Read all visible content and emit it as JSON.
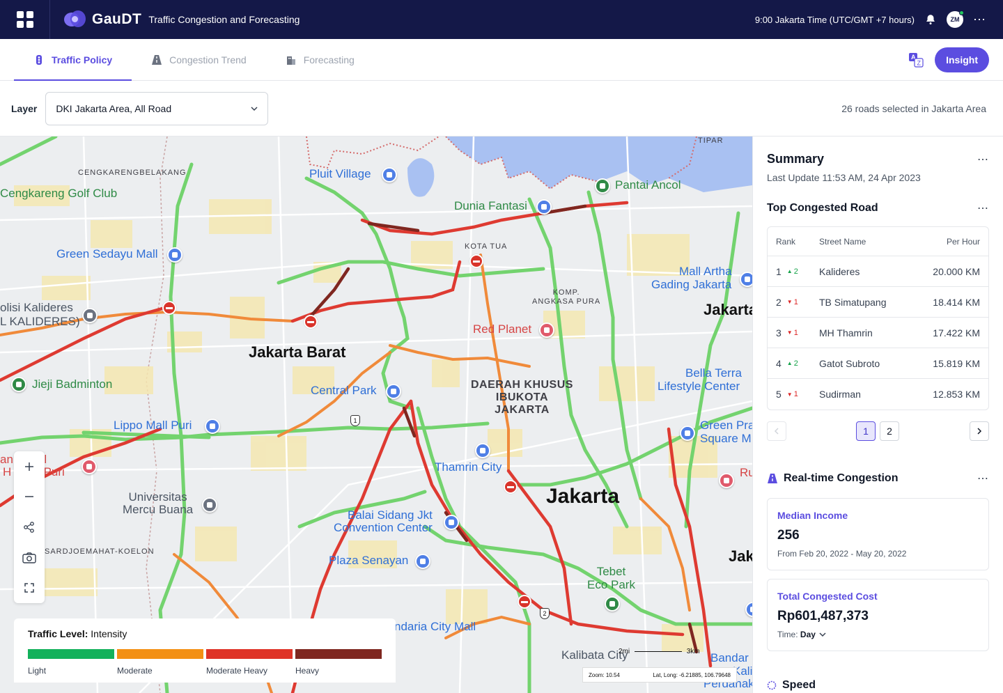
{
  "header": {
    "brand": "GauDT",
    "subtitle": "Traffic Congestion and Forecasting",
    "time": "9:00 Jakarta Time (UTC/GMT +7 hours)",
    "avatar_initials": "ZM",
    "more": "⋯"
  },
  "tabs": [
    {
      "label": "Traffic Policy",
      "active": true,
      "icon": "traffic-light-icon"
    },
    {
      "label": "Congestion Trend",
      "active": false,
      "icon": "road-icon"
    },
    {
      "label": "Forecasting",
      "active": false,
      "icon": "building-icon"
    }
  ],
  "insight_label": "Insight",
  "layer": {
    "label": "Layer",
    "value": "DKI Jakarta Area, All Road",
    "info": "26 roads selected in Jakarta Area"
  },
  "map": {
    "labels": {
      "cengkareng_belakang": "CENGKARENGBELAKANG",
      "golf_club": "Cengkareng Golf Club",
      "pluit_village": "Pluit Village",
      "dunia_fantasi": "Dunia Fantasi",
      "pantai_ancol": "Pantai Ancol",
      "tipar": "TIPAR",
      "kota_tua": "KOTA TUA",
      "green_sedayu": "Green Sedayu Mall",
      "mall_artha": "Mall Artha",
      "gading_jakarta": "Gading Jakarta",
      "komp_angkasa": "KOMP.\nANGKASA PURA",
      "polisi_kalideres": "olisi Kalideres",
      "polisi_kalideres2": "L KALIDERES)",
      "jakarta_right": "Jakarta",
      "red_planet": "Red Planet",
      "jakarta_barat": "Jakarta Barat",
      "jieji": "Jieji Badminton",
      "bella_terra": "Bella Terra",
      "lifestyle_center": "Lifestyle Center",
      "central_park": "Central Park",
      "dki": "DAERAH KHUSUS\nIBUKOTA\nJAKARTA",
      "lippo": "Lippo Mall Puri",
      "green_pra": "Green Pra",
      "square_m": "Square M",
      "royal1": "an Royal",
      "royal2": "H      al Puri",
      "thamrin_city": "Thamrin City",
      "ru": "Ru",
      "universitas": "Universitas\nMercu Buana",
      "jakarta_big": "Jakarta",
      "balai": "Balai Sidang Jkt",
      "convention": "Convention Center",
      "sardjo": "SARDJOEMAHAT-KOELON",
      "jak": "Jak",
      "plaza_senayan": "Plaza Senayan",
      "tebet": "Tebet\nEco Park",
      "ndaria": "ndaria City Mall",
      "kalibata": "Kalibata City",
      "bandar": "Bandar",
      "kali": "Kali",
      "perdanakus": "Perdanakus",
      "shield1": "1",
      "shield2": "2"
    },
    "scale": {
      "mi": "2mi",
      "km": "3km"
    },
    "zoom": "Zoom: 10.54",
    "latlong": "Lat, Long: -6.21885, 106.79648"
  },
  "legend": {
    "title_bold": "Traffic Level:",
    "title_rest": " Intensity",
    "items": [
      {
        "label": "Light",
        "color": "#13b15b"
      },
      {
        "label": "Moderate",
        "color": "#f39014"
      },
      {
        "label": "Moderate Heavy",
        "color": "#df3327"
      },
      {
        "label": "Heavy",
        "color": "#7f2720"
      }
    ]
  },
  "summary": {
    "title": "Summary",
    "last_update": "Last Update 11:53 AM, 24 Apr 2023",
    "top_title": "Top Congested Road",
    "columns": {
      "rank": "Rank",
      "street": "Street Name",
      "value": "Per Hour"
    },
    "rows": [
      {
        "rank": "1",
        "trend": "up",
        "delta": "2",
        "street": "Kalideres",
        "value": "20.000 KM"
      },
      {
        "rank": "2",
        "trend": "down",
        "delta": "1",
        "street": "TB Simatupang",
        "value": "18.414 KM"
      },
      {
        "rank": "3",
        "trend": "down",
        "delta": "1",
        "street": "MH Thamrin",
        "value": "17.422 KM"
      },
      {
        "rank": "4",
        "trend": "up",
        "delta": "2",
        "street": "Gatot Subroto",
        "value": "15.819 KM"
      },
      {
        "rank": "5",
        "trend": "down",
        "delta": "1",
        "street": "Sudirman",
        "value": "12.853 KM"
      }
    ],
    "pages": [
      "1",
      "2"
    ],
    "realtime_title": "Real-time Congestion",
    "median": {
      "title": "Median Income",
      "value": "256",
      "range": "From Feb 20, 2022 - May 20, 2022"
    },
    "cost": {
      "title": "Total Congested Cost",
      "value": "Rp601,487,373",
      "time_label": "Time:",
      "time_value": "Day"
    },
    "speed_title": "Speed"
  },
  "colors": {
    "accent": "#5b4de0",
    "topbar": "#141848"
  }
}
